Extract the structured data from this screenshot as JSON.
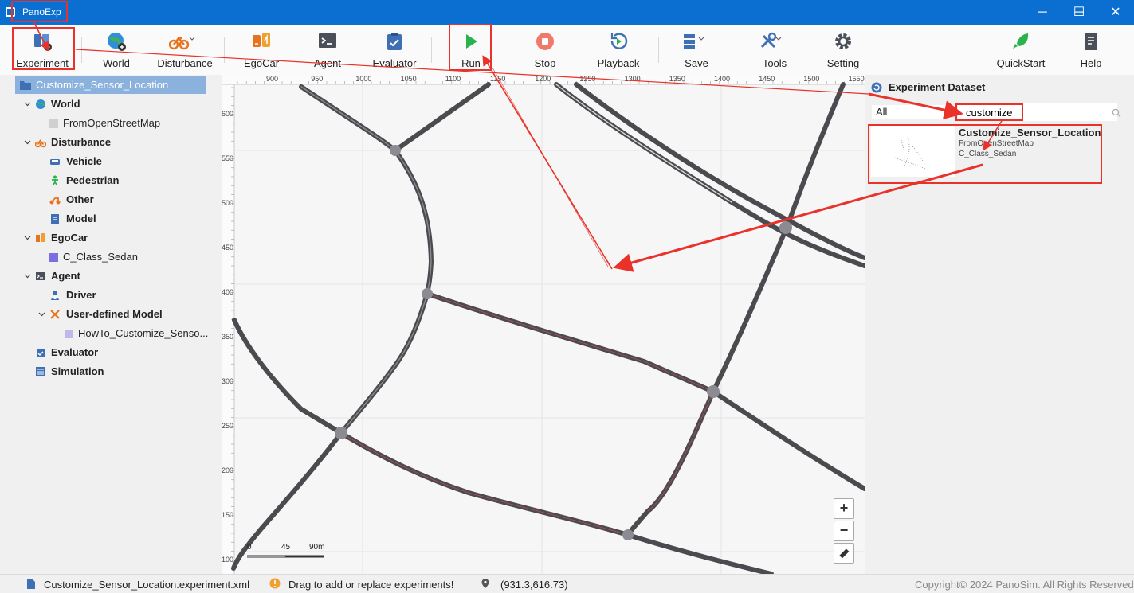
{
  "window": {
    "title": "PanoExp",
    "minimize_glyph": "─",
    "maximize_glyph": "☐",
    "close_glyph": "✕"
  },
  "toolbar": {
    "experiment": "Experiment",
    "world": "World",
    "disturbance": "Disturbance",
    "egocar": "EgoCar",
    "agent": "Agent",
    "evaluator": "Evaluator",
    "run": "Run",
    "stop": "Stop",
    "playback": "Playback",
    "save": "Save",
    "tools": "Tools",
    "setting": "Setting",
    "quickstart": "QuickStart",
    "help": "Help"
  },
  "tree": {
    "root": "Customize_Sensor_Location",
    "world": "World",
    "world_child": "FromOpenStreetMap",
    "disturbance": "Disturbance",
    "vehicle": "Vehicle",
    "pedestrian": "Pedestrian",
    "other": "Other",
    "model": "Model",
    "egocar": "EgoCar",
    "egocar_child": "C_Class_Sedan",
    "agent": "Agent",
    "driver": "Driver",
    "user_model": "User-defined Model",
    "user_model_child": "HowTo_Customize_Senso...",
    "evaluator": "Evaluator",
    "simulation": "Simulation"
  },
  "map": {
    "ruler_x": [
      "900",
      "950",
      "1000",
      "1050",
      "1100",
      "1150",
      "1200",
      "1250",
      "1300",
      "1350",
      "1400",
      "1450",
      "1500",
      "1550"
    ],
    "ruler_y": [
      "600",
      "550",
      "500",
      "450",
      "400",
      "350",
      "300",
      "250",
      "200",
      "150",
      "100"
    ],
    "scale_labels": [
      "0",
      "45",
      "90m"
    ],
    "zoom_in": "+",
    "zoom_out": "−"
  },
  "right_panel": {
    "title": "Experiment Dataset",
    "filter_value": "All",
    "search_value": "customize",
    "result": {
      "name": "Customize_Sensor_Location",
      "world": "FromOpenStreetMap",
      "car": "C_Class_Sedan"
    }
  },
  "status": {
    "file": "Customize_Sensor_Location.experiment.xml",
    "hint": "Drag to add or replace experiments!",
    "coords": "(931.3,616.73)",
    "copyright": "Copyright© 2024 PanoSim. All Rights Reserved"
  },
  "colors": {
    "titlebar": "#0a6fd1",
    "selection": "#8bb1dd",
    "annotation": "#e8322a",
    "road": "#4a4a4f",
    "run_green": "#2bb24c",
    "stop_red": "#f07a6a"
  },
  "icons": [
    "experiment-icon",
    "world-icon",
    "disturbance-icon",
    "egocar-icon",
    "agent-icon",
    "evaluator-icon",
    "run-icon",
    "stop-icon",
    "playback-icon",
    "save-icon",
    "tools-icon",
    "setting-icon",
    "quickstart-icon",
    "help-icon",
    "ruler-icon",
    "search-icon",
    "refresh-icon",
    "location-icon",
    "warning-icon",
    "file-icon"
  ]
}
